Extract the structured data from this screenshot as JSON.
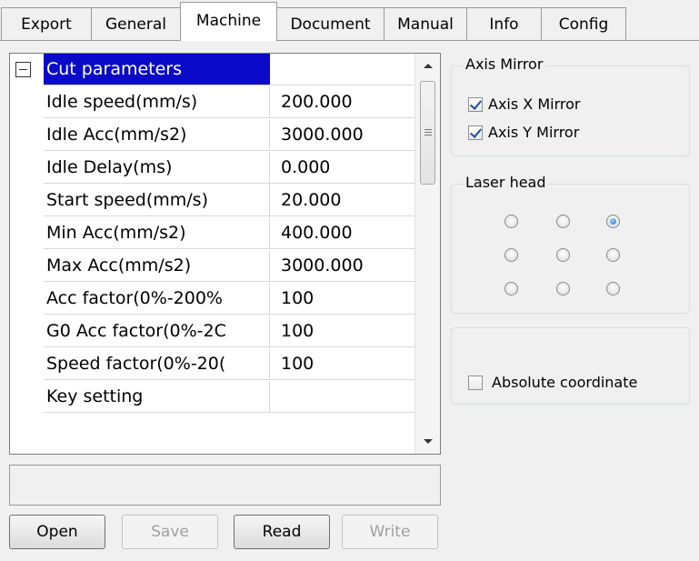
{
  "tabs": [
    {
      "label": "Export"
    },
    {
      "label": "General"
    },
    {
      "label": "Machine",
      "active": true
    },
    {
      "label": "Document"
    },
    {
      "label": "Manual"
    },
    {
      "label": "Info"
    },
    {
      "label": "Config"
    }
  ],
  "grid": {
    "header": "Cut parameters",
    "rows": [
      {
        "name": "Idle speed(mm/s)",
        "value": "200.000"
      },
      {
        "name": "Idle Acc(mm/s2)",
        "value": "3000.000"
      },
      {
        "name": "Idle Delay(ms)",
        "value": "0.000"
      },
      {
        "name": "Start speed(mm/s)",
        "value": "20.000"
      },
      {
        "name": "Min Acc(mm/s2)",
        "value": "400.000"
      },
      {
        "name": "Max Acc(mm/s2)",
        "value": "3000.000"
      },
      {
        "name": "Acc factor(0%-200%",
        "value": "100"
      },
      {
        "name": "G0 Acc factor(0%-2C",
        "value": "100"
      },
      {
        "name": "Speed factor(0%-20(",
        "value": "100"
      },
      {
        "name": "Key setting",
        "value": ""
      }
    ]
  },
  "status_text": "",
  "buttons": {
    "open": "Open",
    "save": "Save",
    "read": "Read",
    "write": "Write"
  },
  "axis_mirror": {
    "title": "Axis Mirror",
    "x_label": "Axis X Mirror",
    "x_checked": true,
    "y_label": "Axis Y Mirror",
    "y_checked": true
  },
  "laser_head": {
    "title": "Laser head",
    "selected_index": 2
  },
  "absolute_coordinate": {
    "label": "Absolute coordinate",
    "checked": false
  },
  "colors": {
    "selection": "#0a0ac8",
    "background": "#f0f0f0",
    "check_mark": "#1d4e9a",
    "radio_dot": "#1f6fc0"
  }
}
